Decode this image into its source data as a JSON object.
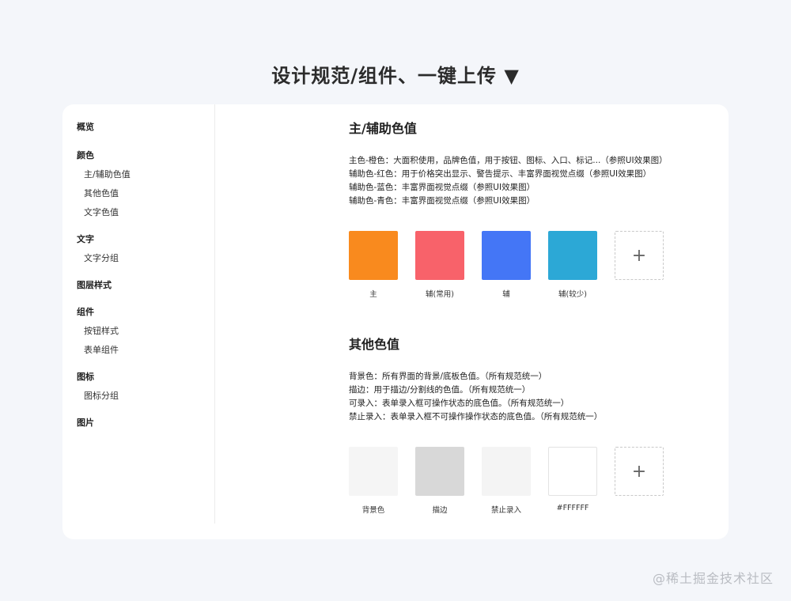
{
  "page_title": "设计规范/组件、一键上传 ▼",
  "sidebar": {
    "groups": [
      {
        "heading": "概览",
        "items": []
      },
      {
        "heading": "颜色",
        "items": [
          "主/辅助色值",
          "其他色值",
          "文字色值"
        ]
      },
      {
        "heading": "文字",
        "items": [
          "文字分组"
        ]
      },
      {
        "heading": "图层样式",
        "items": []
      },
      {
        "heading": "组件",
        "items": [
          "按钮样式",
          "表单组件"
        ]
      },
      {
        "heading": "图标",
        "items": [
          "图标分组"
        ]
      },
      {
        "heading": "图片",
        "items": []
      }
    ]
  },
  "primary_section": {
    "title": "主/辅助色值",
    "lines": [
      "主色-橙色：大面积使用，品牌色值，用于按钮、图标、入口、标记...（参照UI效果图）",
      "辅助色-红色：用于价格突出显示、警告提示、丰富界面视觉点缀（参照UI效果图）",
      "辅助色-蓝色：丰富界面视觉点缀（参照UI效果图）",
      "辅助色-青色：丰富界面视觉点缀（参照UI效果图）"
    ],
    "swatches": [
      {
        "label": "主",
        "color": "#f98a1e"
      },
      {
        "label": "辅(常用)",
        "color": "#f8626a"
      },
      {
        "label": "辅",
        "color": "#4476f6"
      },
      {
        "label": "辅(较少)",
        "color": "#2ca8d6"
      }
    ],
    "add_icon": "+"
  },
  "other_section": {
    "title": "其他色值",
    "lines": [
      "背景色：所有界面的背景/底板色值。（所有规范统一）",
      "描边：用于描边/分割线的色值。（所有规范统一）",
      "可录入：表单录入框可操作状态的底色值。（所有规范统一）",
      "禁止录入：表单录入框不可操作操作状态的底色值。（所有规范统一）"
    ],
    "swatches": [
      {
        "label": "背景色",
        "color": "#f5f5f5"
      },
      {
        "label": "描边",
        "color": "#d8d8d8"
      },
      {
        "label": "禁止录入",
        "color": "#f4f4f4"
      },
      {
        "label": "#FFFFFF",
        "color": "#ffffff"
      }
    ],
    "add_icon": "+"
  },
  "watermark": "@稀土掘金技术社区",
  "colors": {
    "page_bg": "#f4f6fa",
    "card_bg": "#ffffff"
  }
}
